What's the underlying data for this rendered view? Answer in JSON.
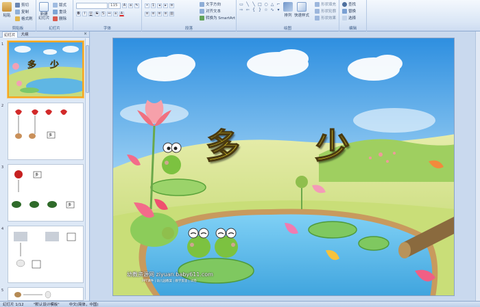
{
  "ribbon": {
    "clipboard": {
      "paste": "粘贴",
      "cut": "剪切",
      "copy": "复制",
      "format_painter": "格式刷",
      "label": "剪贴板"
    },
    "slides": {
      "new_slide": "新建\n幻灯片",
      "layout": "版式",
      "reset": "重设",
      "delete": "删除",
      "label": "幻灯片"
    },
    "font": {
      "size": "115",
      "label": "字体"
    },
    "paragraph": {
      "text_direction": "文字方向",
      "align_text": "对齐文本",
      "smartart": "转换为 SmartArt",
      "label": "段落"
    },
    "drawing": {
      "arrange": "排列",
      "quick_styles": "快速样式",
      "shape_fill": "形状填充",
      "shape_outline": "形状轮廓",
      "shape_effects": "形状效果",
      "label": "绘图"
    },
    "editing": {
      "find": "查找",
      "replace": "替换",
      "select": "选择",
      "label": "编辑"
    }
  },
  "left_pane": {
    "tabs": [
      "幻灯片",
      "大纲"
    ],
    "close": "×",
    "thumb1_chars": [
      "多",
      "少"
    ],
    "thumb2_label": "多",
    "thumb3_top_label": "多",
    "thumb3_bottom_label": "多",
    "slide_numbers": [
      "1",
      "2",
      "3",
      "4",
      "5"
    ]
  },
  "slide": {
    "char_left": "多",
    "char_right": "少",
    "watermark": "幼教资源网 ziyuan.baby611.com",
    "watermark_sub": "PPT课件 | 幼儿园教案 | 教学反思 | 试卷"
  },
  "statusbar": {
    "slide_counter": "幻灯片 1/12",
    "theme": "\"默认设计模板\"",
    "language": "中文(简体，中国)"
  },
  "colors": {
    "ribbon_bg": "#dbe7f6",
    "selected_thumb": "#f5a623",
    "char_fill": "#f7e12a"
  }
}
